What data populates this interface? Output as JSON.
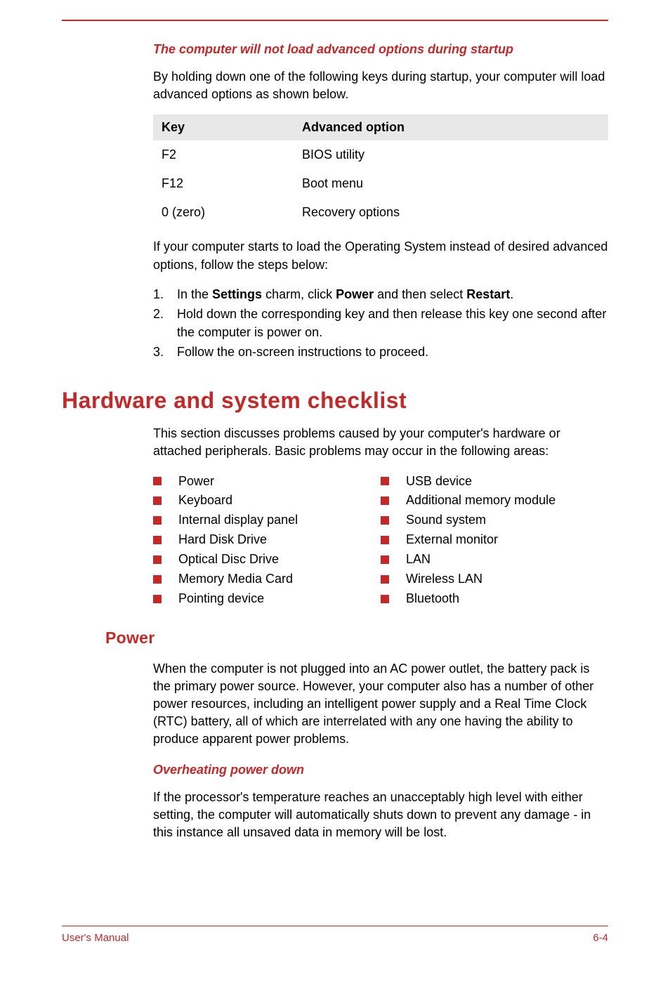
{
  "section1": {
    "title": "The computer will not load advanced options during startup",
    "intro": "By holding down one of the following keys during startup, your computer will load advanced options as shown below.",
    "table": {
      "headers": {
        "key": "Key",
        "option": "Advanced option"
      },
      "rows": [
        {
          "key": "F2",
          "option": "BIOS utility"
        },
        {
          "key": "F12",
          "option": "Boot menu"
        },
        {
          "key": "0 (zero)",
          "option": "Recovery options"
        }
      ]
    },
    "after_table": "If your computer starts to load the Operating System instead of desired advanced options, follow the steps below:",
    "steps": [
      {
        "num": "1.",
        "prefix": "In the ",
        "bold1": "Settings",
        "mid1": " charm, click ",
        "bold2": "Power",
        "mid2": " and then select ",
        "bold3": "Restart",
        "suffix": "."
      },
      {
        "num": "2.",
        "text": "Hold down the corresponding key and then release this key one second after the computer is power on."
      },
      {
        "num": "3.",
        "text": "Follow the on-screen instructions to proceed."
      }
    ]
  },
  "section2": {
    "title": "Hardware and system checklist",
    "intro": "This section discusses problems caused by your computer's hardware or attached peripherals. Basic problems may occur in the following areas:",
    "left_list": [
      "Power",
      "Keyboard",
      "Internal display panel",
      "Hard Disk Drive",
      "Optical Disc Drive",
      "Memory Media Card",
      "Pointing device"
    ],
    "right_list": [
      "USB device",
      "Additional memory module",
      "Sound system",
      "External monitor",
      "LAN",
      "Wireless LAN",
      "Bluetooth"
    ]
  },
  "power": {
    "title": "Power",
    "para": "When the computer is not plugged into an AC power outlet, the battery pack is the primary power source. However, your computer also has a number of other power resources, including an intelligent power supply and a Real Time Clock (RTC) battery, all of which are interrelated with any one having the ability to produce apparent power problems."
  },
  "overheating": {
    "title": "Overheating power down",
    "para": "If the processor's temperature reaches an unacceptably high level with either setting, the computer will automatically shuts down to prevent any damage - in this instance all unsaved data in memory will be lost."
  },
  "footer": {
    "left": "User's Manual",
    "right": "6-4"
  }
}
